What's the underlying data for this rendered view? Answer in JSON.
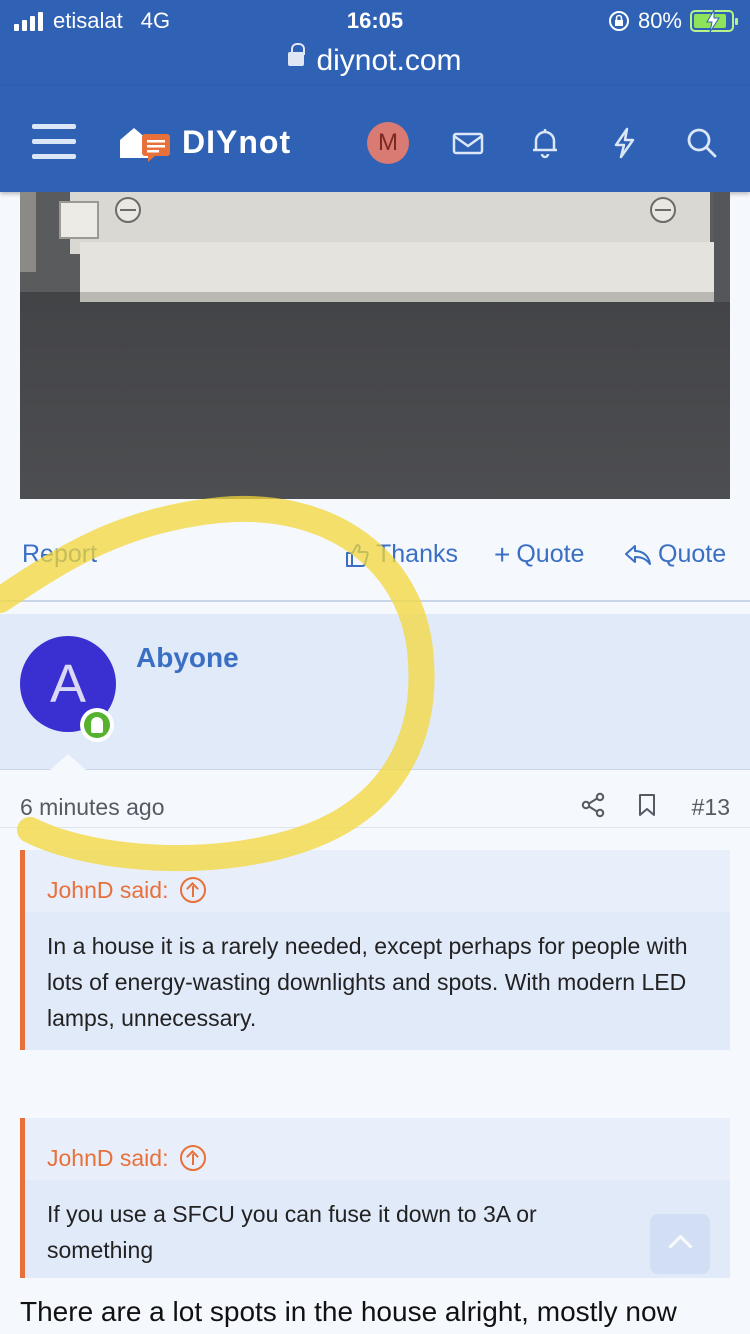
{
  "status_bar": {
    "carrier": "etisalat",
    "network": "4G",
    "time": "16:05",
    "battery": "80%"
  },
  "url_bar": {
    "domain": "diynot.com"
  },
  "header": {
    "logo_text": "DIYnot",
    "user_initial": "M"
  },
  "post_actions": {
    "report": "Report",
    "thanks": "Thanks",
    "multi_quote": "Quote",
    "reply_quote": "Quote"
  },
  "post": {
    "author": "Abyone",
    "avatar_letter": "A",
    "time": "6 minutes ago",
    "number": "#13",
    "quotes": [
      {
        "author_line": "JohnD said:",
        "text": "In a house it is a rarely needed, except perhaps for people with lots of energy-wasting downlights and spots. With modern LED lamps, unnecessary."
      },
      {
        "author_line": "JohnD said:",
        "text": "If you use a SFCU you can fuse it down to 3A or something"
      }
    ],
    "body_start": "There are a lot spots in the house alright, mostly now"
  },
  "colors": {
    "header_bg": "#2f61b5",
    "link": "#3a6fc4",
    "quote_accent": "#e8703a",
    "avatar_bg": "#3a2fd0",
    "online": "#56b22e"
  }
}
